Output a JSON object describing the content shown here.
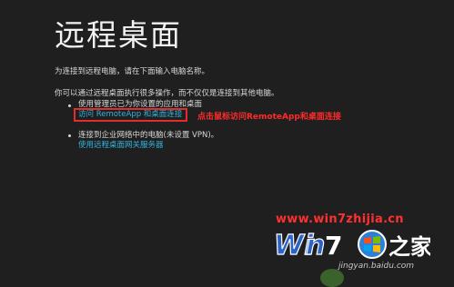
{
  "page": {
    "title": "远程桌面",
    "intro": "为连接到远程电脑，请在下面输入电脑名称。",
    "more": "你可以通过远程桌面执行很多操作，而不仅仅是连接到其他电脑。",
    "items": [
      {
        "text": "使用管理员已为你设置的应用和桌面",
        "link": "访问 RemoteApp 和桌面连接"
      },
      {
        "text": "连接到企业网络中的电脑(未设置 VPN)。",
        "link": "使用远程桌面网关服务器"
      }
    ]
  },
  "annotation": "点击鼠标访问RemoteApp和桌面连接",
  "watermark": {
    "url": "www.win7zhijia.cn",
    "logo_text": "Win7之家",
    "site": "jingyan.baidu.com"
  },
  "colors": {
    "background": "#1f1f1f",
    "link": "#31b4e0",
    "highlight": "#e32d2d",
    "annotation": "#ff2b2b"
  }
}
